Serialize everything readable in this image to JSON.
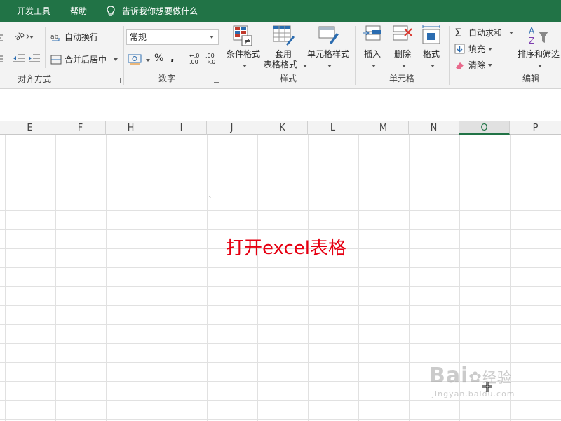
{
  "menubar": {
    "tabs": [
      "开发工具",
      "帮助"
    ],
    "tell_me": "告诉我你想要做什么"
  },
  "ribbon": {
    "alignment": {
      "wrap_text": "自动换行",
      "merge_center": "合并后居中",
      "label": "对齐方式"
    },
    "number": {
      "format": "常规",
      "percent": "%",
      "comma": ",",
      "inc_decimal_top": "←.0",
      "inc_decimal_bottom": ".00",
      "dec_decimal_top": ".00",
      "dec_decimal_bottom": "→.0",
      "label": "数字"
    },
    "styles": {
      "conditional": "条件格式",
      "table_line1": "套用",
      "table_line2": "表格格式",
      "cell_styles": "单元格样式",
      "label": "样式"
    },
    "cells": {
      "insert": "插入",
      "delete": "删除",
      "format": "格式",
      "label": "单元格"
    },
    "editing": {
      "autosum": "自动求和",
      "fill": "填充",
      "clear": "清除",
      "sort_filter": "排序和筛选",
      "label": "编辑"
    }
  },
  "columns": [
    "E",
    "F",
    "H",
    "I",
    "J",
    "K",
    "L",
    "M",
    "N",
    "O",
    "P"
  ],
  "active_column": "O",
  "sheet": {
    "annotation": "打开excel表格",
    "tick_mark": "`"
  },
  "watermark": {
    "brand": "Bai",
    "suffix": "经验",
    "url": "jingyan.baidu.com"
  },
  "colors": {
    "excel_green": "#217346",
    "annotation_red": "#e60012"
  }
}
